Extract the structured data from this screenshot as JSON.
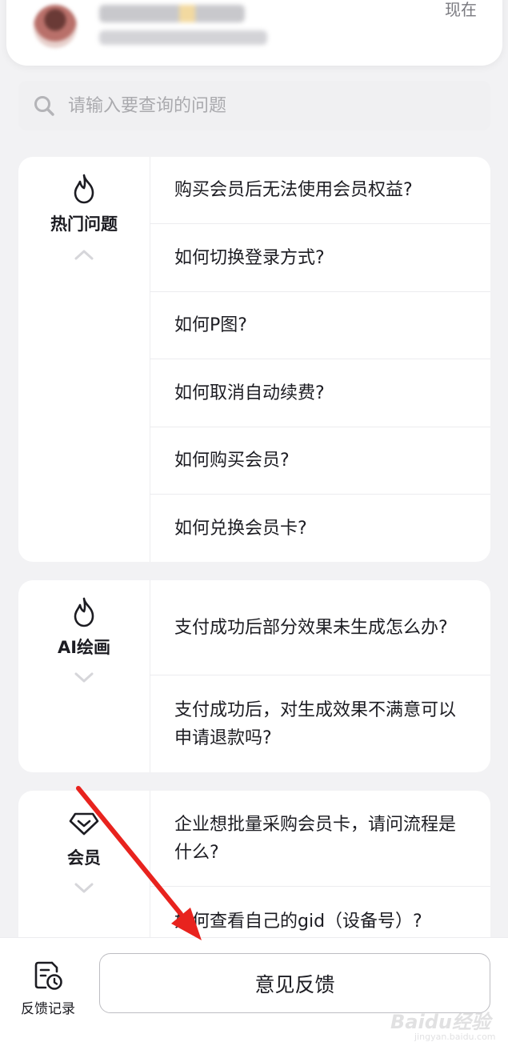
{
  "notification": {
    "time": "现在"
  },
  "search": {
    "placeholder": "请输入要查询的问题"
  },
  "categories": [
    {
      "label": "热门问题",
      "icon": "flame-icon",
      "expanded": true,
      "questions": [
        "购买会员后无法使用会员权益?",
        "如何切换登录方式?",
        "如何P图?",
        "如何取消自动续费?",
        "如何购买会员?",
        "如何兑换会员卡?"
      ]
    },
    {
      "label": "AI绘画",
      "icon": "flame-icon",
      "expanded": false,
      "questions": [
        "支付成功后部分效果未生成怎么办?",
        "支付成功后，对生成效果不满意可以申请退款吗?"
      ]
    },
    {
      "label": "会员",
      "icon": "diamond-icon",
      "expanded": false,
      "questions": [
        "企业想批量采购会员卡，请问流程是什么?",
        "如何查看自己的gid（设备号）?"
      ]
    }
  ],
  "bottom": {
    "record_label": "反馈记录",
    "feedback_button": "意见反馈"
  },
  "watermark": {
    "text": "Baidu经验",
    "sub": "jingyan.baidu.com"
  },
  "colors": {
    "arrow": "#e8231e",
    "card": "#ffffff",
    "background": "#f2f2f4"
  }
}
